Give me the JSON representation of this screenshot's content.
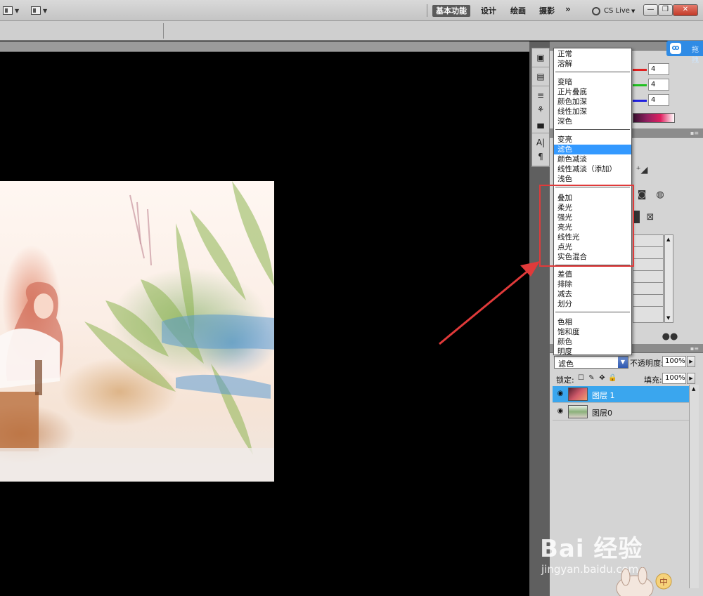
{
  "workspace": {
    "tabs": [
      "基本功能",
      "设计",
      "绘画",
      "摄影"
    ],
    "active": "基本功能",
    "more": "»",
    "cs_live": "CS Live"
  },
  "window_buttons": [
    "—",
    "❐",
    "✕"
  ],
  "color_panel": {
    "channels": [
      {
        "color": "#e02020",
        "value": "4"
      },
      {
        "color": "#20c020",
        "value": "4"
      },
      {
        "color": "#2020e0",
        "value": "4"
      }
    ]
  },
  "blend_menu": {
    "selected": "滤色",
    "groups": [
      [
        "正常",
        "溶解"
      ],
      [
        "变暗",
        "正片叠底",
        "颜色加深",
        "线性加深",
        "深色"
      ],
      [
        "变亮",
        "滤色",
        "颜色减淡",
        "线性减淡（添加）",
        "浅色"
      ],
      [
        "叠加",
        "柔光",
        "强光",
        "亮光",
        "线性光",
        "点光",
        "实色混合"
      ],
      [
        "差值",
        "排除",
        "减去",
        "划分"
      ],
      [
        "色相",
        "饱和度",
        "颜色",
        "明度"
      ]
    ]
  },
  "layers_panel": {
    "blend_value": "滤色",
    "opacity_label": "不透明度:",
    "opacity_value": "100%",
    "lock_label": "锁定:",
    "fill_label": "填充:",
    "fill_value": "100%",
    "layers": [
      {
        "name": "图层 1",
        "selected": true
      },
      {
        "name": "图层0",
        "selected": false
      }
    ]
  },
  "badge": {
    "text": "拖拽"
  },
  "watermark": {
    "logo": "Bai 经验",
    "url": "jingyan.baidu.com",
    "mascot_char": "中"
  },
  "icons": {
    "arrange": "arrange-documents-icon",
    "screen_mode": "screen-mode-icon",
    "annotation": "red-arrow-annotation"
  }
}
